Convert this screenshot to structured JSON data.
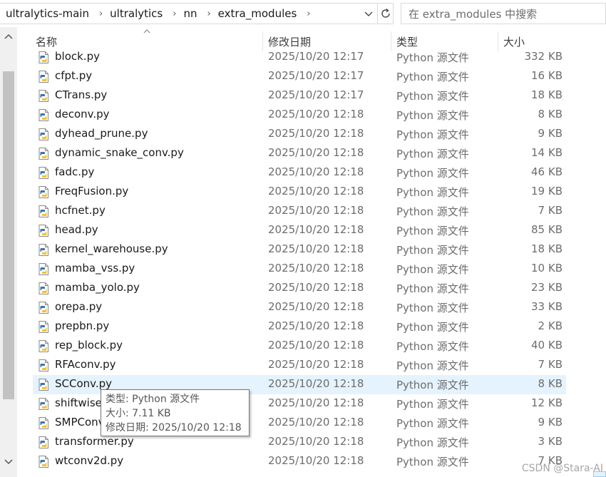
{
  "address": {
    "crumbs": [
      "ultralytics-main",
      "ultralytics",
      "nn",
      "extra_modules"
    ],
    "search_placeholder": "在 extra_modules 中搜索"
  },
  "columns": {
    "name": "名称",
    "date": "修改日期",
    "type": "类型",
    "size": "大小"
  },
  "files": [
    {
      "name": "block.py",
      "date": "2025/10/20 12:17",
      "type": "Python 源文件",
      "size": "332 KB"
    },
    {
      "name": "cfpt.py",
      "date": "2025/10/20 12:17",
      "type": "Python 源文件",
      "size": "16 KB"
    },
    {
      "name": "CTrans.py",
      "date": "2025/10/20 12:17",
      "type": "Python 源文件",
      "size": "18 KB"
    },
    {
      "name": "deconv.py",
      "date": "2025/10/20 12:18",
      "type": "Python 源文件",
      "size": "8 KB"
    },
    {
      "name": "dyhead_prune.py",
      "date": "2025/10/20 12:18",
      "type": "Python 源文件",
      "size": "9 KB"
    },
    {
      "name": "dynamic_snake_conv.py",
      "date": "2025/10/20 12:18",
      "type": "Python 源文件",
      "size": "14 KB"
    },
    {
      "name": "fadc.py",
      "date": "2025/10/20 12:18",
      "type": "Python 源文件",
      "size": "46 KB"
    },
    {
      "name": "FreqFusion.py",
      "date": "2025/10/20 12:18",
      "type": "Python 源文件",
      "size": "19 KB"
    },
    {
      "name": "hcfnet.py",
      "date": "2025/10/20 12:18",
      "type": "Python 源文件",
      "size": "7 KB"
    },
    {
      "name": "head.py",
      "date": "2025/10/20 12:18",
      "type": "Python 源文件",
      "size": "85 KB"
    },
    {
      "name": "kernel_warehouse.py",
      "date": "2025/10/20 12:18",
      "type": "Python 源文件",
      "size": "18 KB"
    },
    {
      "name": "mamba_vss.py",
      "date": "2025/10/20 12:18",
      "type": "Python 源文件",
      "size": "10 KB"
    },
    {
      "name": "mamba_yolo.py",
      "date": "2025/10/20 12:18",
      "type": "Python 源文件",
      "size": "23 KB"
    },
    {
      "name": "orepa.py",
      "date": "2025/10/20 12:18",
      "type": "Python 源文件",
      "size": "33 KB"
    },
    {
      "name": "prepbn.py",
      "date": "2025/10/20 12:18",
      "type": "Python 源文件",
      "size": "2 KB"
    },
    {
      "name": "rep_block.py",
      "date": "2025/10/20 12:18",
      "type": "Python 源文件",
      "size": "40 KB"
    },
    {
      "name": "RFAconv.py",
      "date": "2025/10/20 12:18",
      "type": "Python 源文件",
      "size": "7 KB"
    },
    {
      "name": "SCConv.py",
      "date": "2025/10/20 12:18",
      "type": "Python 源文件",
      "size": "8 KB"
    },
    {
      "name": "shiftwise",
      "date": "2025/10/20 12:18",
      "type": "Python 源文件",
      "size": "12 KB"
    },
    {
      "name": "SMPConv",
      "date": "2025/10/20 12:18",
      "type": "Python 源文件",
      "size": "9 KB"
    },
    {
      "name": "transformer.py",
      "date": "2025/10/20 12:18",
      "type": "Python 源文件",
      "size": "3 KB"
    },
    {
      "name": "wtconv2d.py",
      "date": "2025/10/20 12:18",
      "type": "Python 源文件",
      "size": "7 KB"
    }
  ],
  "hovered_index": 17,
  "tooltip": {
    "line1": "类型: Python 源文件",
    "line2": "大小: 7.11 KB",
    "line3": "修改日期: 2025/10/20 12:18"
  },
  "watermark": "CSDN @Stara-AI",
  "colors": {
    "hover_bg": "#e5f3ff",
    "python_blue": "#3a75b0",
    "python_yellow": "#f2c232"
  }
}
